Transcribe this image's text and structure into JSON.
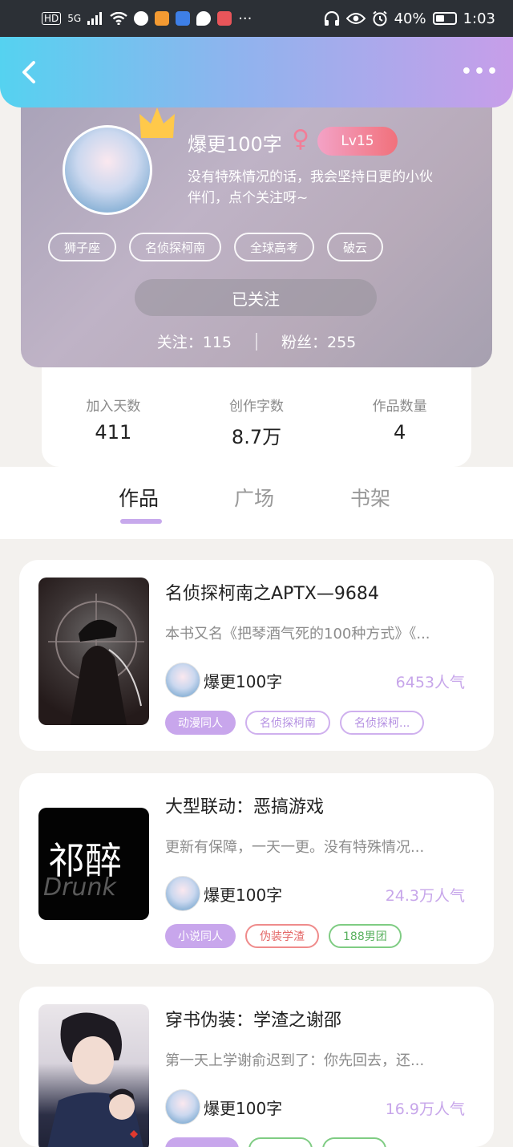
{
  "status_bar": {
    "left": [
      "HD",
      "5G"
    ],
    "battery": "40%",
    "time": "1:03"
  },
  "header": {
    "back_icon": "chevron-left-icon",
    "more_icon": "more-dots-icon",
    "more_label": "•••"
  },
  "profile": {
    "nickname": "爆更100字",
    "gender_symbol": "♀",
    "level": "Lv15",
    "bio": "没有特殊情况的话，我会坚持日更的小伙伴们，点个关注呀~",
    "tags": [
      "狮子座",
      "名侦探柯南",
      "全球高考",
      "破云"
    ],
    "follow_button": "已关注",
    "following_text": "关注：115",
    "followers_text": "粉丝：255"
  },
  "stats": [
    {
      "label": "加入天数",
      "value": "411"
    },
    {
      "label": "创作字数",
      "value": "8.7万"
    },
    {
      "label": "作品数量",
      "value": "4"
    }
  ],
  "tabs": [
    "作品",
    "广场",
    "书架"
  ],
  "books": [
    {
      "title": "名侦探柯南之APTX—9684",
      "desc": "本书又名《把琴酒气死的100种方式》《...",
      "author": "爆更100字",
      "popularity": "6453人气",
      "tags": [
        {
          "label": "动漫同人",
          "style": "fill"
        },
        {
          "label": "名侦探柯南",
          "style": "purple"
        },
        {
          "label": "名侦探柯...",
          "style": "purple"
        }
      ]
    },
    {
      "title": "大型联动：恶搞游戏",
      "desc": "更新有保障，一天一更。没有特殊情况...",
      "author": "爆更100字",
      "popularity": "24.3万人气",
      "cover_text": "祁醉",
      "cover_sub": "Drunk",
      "tags": [
        {
          "label": "小说同人",
          "style": "fill"
        },
        {
          "label": "伪装学渣",
          "style": "red"
        },
        {
          "label": "188男团",
          "style": "green"
        }
      ]
    },
    {
      "title": "穿书伪装：学渣之谢邵",
      "desc": "第一天上学谢俞迟到了：你先回去，还...",
      "author": "爆更100字",
      "popularity": "16.9万人气",
      "tags": []
    }
  ],
  "colors": {
    "header_gradient": [
      "#55d2f0",
      "#8eb4ee",
      "#c79ee9"
    ],
    "accent_purple": "#c8a6ec",
    "level_badge": [
      "#f3a2c6",
      "#f1717b"
    ],
    "popularity": "#c7a6ea"
  }
}
